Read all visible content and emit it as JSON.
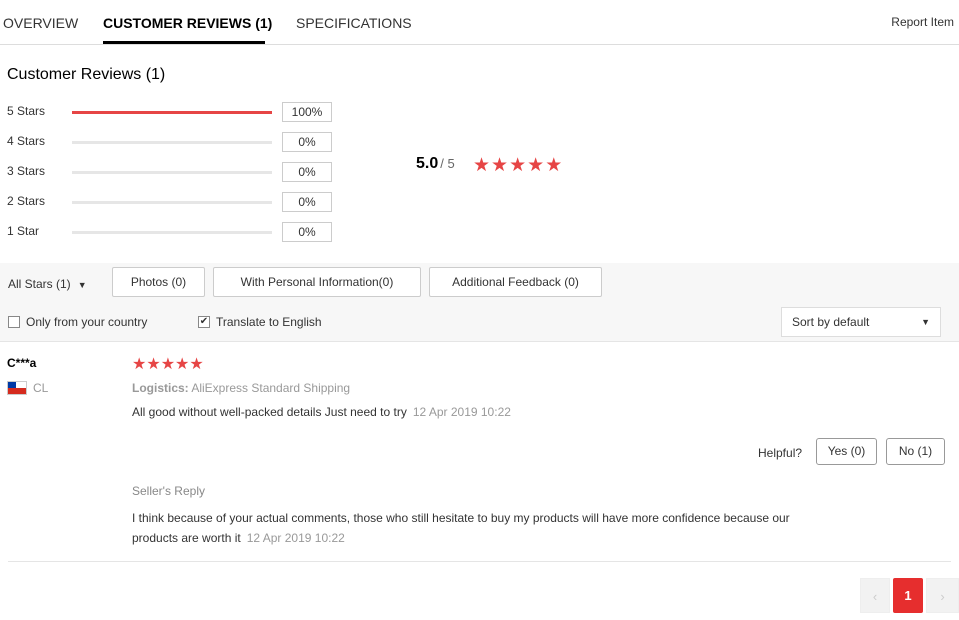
{
  "tabs": {
    "overview": "OVERVIEW",
    "reviews": "CUSTOMER REVIEWS (1)",
    "specs": "SPECIFICATIONS",
    "report": "Report Item"
  },
  "summary": {
    "title": "Customer Reviews (1)",
    "rows": [
      {
        "label": "5 Stars",
        "pct": "100%",
        "fraction": 1.0
      },
      {
        "label": "4 Stars",
        "pct": "0%",
        "fraction": 0
      },
      {
        "label": "3 Stars",
        "pct": "0%",
        "fraction": 0
      },
      {
        "label": "2 Stars",
        "pct": "0%",
        "fraction": 0
      },
      {
        "label": "1 Star",
        "pct": "0%",
        "fraction": 0
      }
    ],
    "average": "5.0",
    "out_of": "/ 5",
    "star_rating": 5,
    "star_color": "#e64545"
  },
  "filters": {
    "all_stars": "All Stars (1)",
    "photos": "Photos (0)",
    "personal": "With Personal Information(0)",
    "additional": "Additional Feedback (0)",
    "only_country": "Only from your country",
    "only_country_checked": false,
    "translate": "Translate to English",
    "translate_checked": true,
    "sort": "Sort by default"
  },
  "review": {
    "name": "C***a",
    "country": "CL",
    "flag_icon": "chile-flag-icon",
    "stars": 5,
    "logistics_label": "Logistics:",
    "logistics_value": "AliExpress Standard Shipping",
    "text": "All good without well-packed details Just need to try",
    "date": "12 Apr 2019 10:22",
    "helpful_label": "Helpful?",
    "yes": "Yes (0)",
    "no": "No (1)",
    "seller_label": "Seller's Reply",
    "seller_text": "I think because of your actual comments, those who still hesitate to buy my products will have more confidence because our products are worth it",
    "seller_date": "12 Apr 2019 10:22"
  },
  "pagination": {
    "prev": "‹",
    "current": "1",
    "next": "›",
    "accent": "#e62e2e"
  }
}
